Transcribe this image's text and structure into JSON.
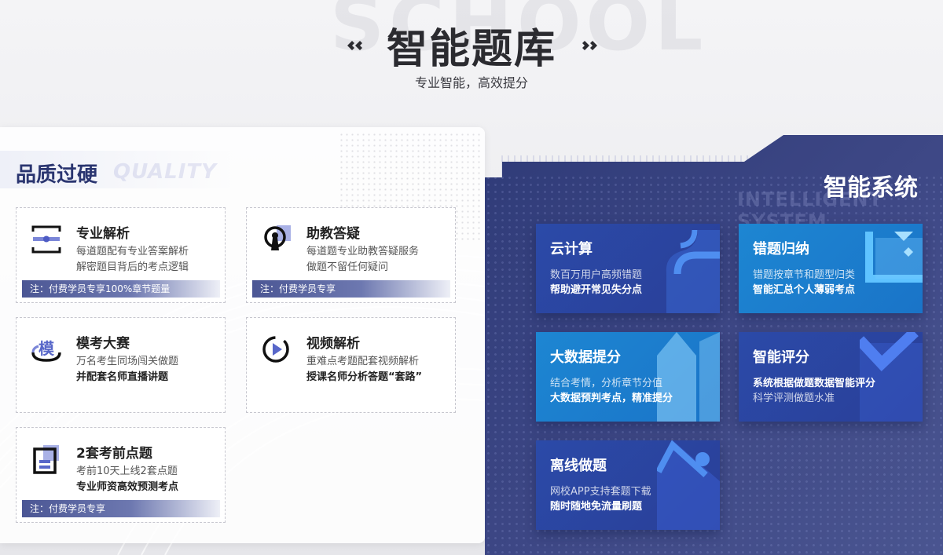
{
  "hero": {
    "watermark": "SCHOOL",
    "title": "智能题库",
    "subtitle": "专业智能，高效提分"
  },
  "quality": {
    "title": "品质过硬",
    "title_en": "QUALITY",
    "cards": [
      {
        "title": "专业解析",
        "line1": "每道题配有专业答案解析",
        "line2": "解密题目背后的考点逻辑",
        "note": "注：付费学员专享100%章节题量",
        "icon": "scan-icon"
      },
      {
        "title": "助教答疑",
        "line1": "每道题专业助教答疑服务",
        "line2": "做题不留任何疑问",
        "note": "注：付费学员专享",
        "icon": "keyhole-icon"
      },
      {
        "title": "模考大赛",
        "line1": "万名考生同场闯关做题",
        "line2": "并配套名师直播讲题",
        "note": "",
        "icon": "mock-exam-icon",
        "icon_text": "模"
      },
      {
        "title": "视频解析",
        "line1": "重难点考题配套视频解析",
        "line2": "授课名师分析答题“套路”",
        "note": "",
        "icon": "play-icon"
      },
      {
        "title": "2套考前点题",
        "line1": "考前10天上线2套点题",
        "line2": "专业师资高效预测考点",
        "note": "注：付费学员专享",
        "icon": "document-icon"
      }
    ]
  },
  "intelligent": {
    "title": "智能系统",
    "title_en": "INTELLIGENT SYSTEM",
    "tiles": [
      {
        "title": "云计算",
        "line1": "数百万用户高频错题",
        "line2": "帮助避开常见失分点",
        "icon": "cloud-icon"
      },
      {
        "title": "错题归纳",
        "line1": "错题按章节和题型归类",
        "line2": "智能汇总个人薄弱考点",
        "icon": "collect-icon"
      },
      {
        "title": "大数据提分",
        "line1": "结合考情，分析章节分值",
        "line2": "大数据预判考点，精准提分",
        "icon": "bar-up-icon"
      },
      {
        "title": "智能评分",
        "line1": "系统根据做题数据智能评分",
        "line2": "科学评测做题水准",
        "icon": "check-icon"
      },
      {
        "title": "离线做题",
        "line1": "网校APP支持套题下载",
        "line2": "随时随地免流量刷题",
        "icon": "offline-icon"
      }
    ]
  }
}
